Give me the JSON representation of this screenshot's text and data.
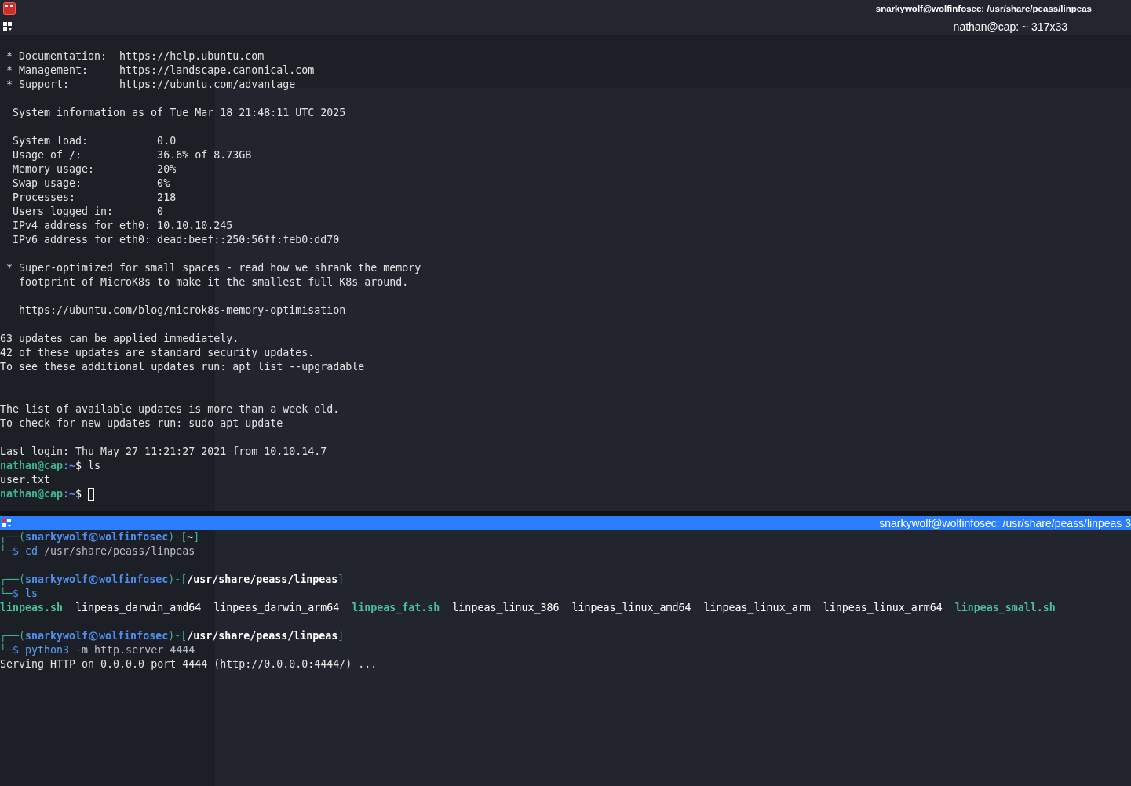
{
  "window": {
    "title": "snarkywolf@wolfinfosec: /usr/share/peass/linpeas"
  },
  "panes": [
    {
      "title": "nathan@cap: ~ 317x33",
      "active": false,
      "lines": [
        {
          "kind": "text",
          "segments": [
            {
              "kind": "output",
              "text": " * Documentation:  https://help.ubuntu.com"
            }
          ]
        },
        {
          "kind": "text",
          "segments": [
            {
              "kind": "output",
              "text": " * Management:     https://landscape.canonical.com"
            }
          ]
        },
        {
          "kind": "text",
          "segments": [
            {
              "kind": "output",
              "text": " * Support:        https://ubuntu.com/advantage"
            }
          ]
        },
        {
          "kind": "blank"
        },
        {
          "kind": "text",
          "segments": [
            {
              "kind": "output",
              "text": "  System information as of Tue Mar 18 21:48:11 UTC 2025"
            }
          ]
        },
        {
          "kind": "blank"
        },
        {
          "kind": "text",
          "segments": [
            {
              "kind": "output",
              "text": "  System load:           0.0"
            }
          ]
        },
        {
          "kind": "text",
          "segments": [
            {
              "kind": "output",
              "text": "  Usage of /:            36.6% of 8.73GB"
            }
          ]
        },
        {
          "kind": "text",
          "segments": [
            {
              "kind": "output",
              "text": "  Memory usage:          20%"
            }
          ]
        },
        {
          "kind": "text",
          "segments": [
            {
              "kind": "output",
              "text": "  Swap usage:            0%"
            }
          ]
        },
        {
          "kind": "text",
          "segments": [
            {
              "kind": "output",
              "text": "  Processes:             218"
            }
          ]
        },
        {
          "kind": "text",
          "segments": [
            {
              "kind": "output",
              "text": "  Users logged in:       0"
            }
          ]
        },
        {
          "kind": "text",
          "segments": [
            {
              "kind": "output",
              "text": "  IPv4 address for eth0: 10.10.10.245"
            }
          ]
        },
        {
          "kind": "text",
          "segments": [
            {
              "kind": "output",
              "text": "  IPv6 address for eth0: dead:beef::250:56ff:feb0:dd70"
            }
          ]
        },
        {
          "kind": "blank"
        },
        {
          "kind": "text",
          "segments": [
            {
              "kind": "output",
              "text": " * Super-optimized for small spaces - read how we shrank the memory"
            }
          ]
        },
        {
          "kind": "text",
          "segments": [
            {
              "kind": "output",
              "text": "   footprint of MicroK8s to make it the smallest full K8s around."
            }
          ]
        },
        {
          "kind": "blank"
        },
        {
          "kind": "text",
          "segments": [
            {
              "kind": "output",
              "text": "   https://ubuntu.com/blog/microk8s-memory-optimisation"
            }
          ]
        },
        {
          "kind": "blank"
        },
        {
          "kind": "text",
          "segments": [
            {
              "kind": "output",
              "text": "63 updates can be applied immediately."
            }
          ]
        },
        {
          "kind": "text",
          "segments": [
            {
              "kind": "output",
              "text": "42 of these updates are standard security updates."
            }
          ]
        },
        {
          "kind": "text",
          "segments": [
            {
              "kind": "output",
              "text": "To see these additional updates run: apt list --upgradable"
            }
          ]
        },
        {
          "kind": "blank"
        },
        {
          "kind": "blank"
        },
        {
          "kind": "text",
          "segments": [
            {
              "kind": "output",
              "text": "The list of available updates is more than a week old."
            }
          ]
        },
        {
          "kind": "text",
          "segments": [
            {
              "kind": "output",
              "text": "To check for new updates run: sudo apt update"
            }
          ]
        },
        {
          "kind": "blank"
        },
        {
          "kind": "text",
          "segments": [
            {
              "kind": "output",
              "text": "Last login: Thu May 27 11:21:27 2021 from 10.10.14.7"
            }
          ]
        },
        {
          "kind": "text",
          "segments": [
            {
              "kind": "user",
              "text": "nathan@cap"
            },
            {
              "kind": "path",
              "text": ":~"
            },
            {
              "kind": "dollar",
              "text": "$"
            },
            {
              "kind": "command",
              "text": "ls"
            }
          ]
        },
        {
          "kind": "text",
          "segments": [
            {
              "kind": "output",
              "text": "user.txt"
            }
          ]
        },
        {
          "kind": "text",
          "segments": [
            {
              "kind": "user",
              "text": "nathan@cap"
            },
            {
              "kind": "path",
              "text": ":~"
            },
            {
              "kind": "dollar",
              "text": "$"
            },
            {
              "kind": "cursor"
            }
          ]
        }
      ]
    },
    {
      "title": "snarkywolf@wolfinfosec: /usr/share/peass/linpeas 3",
      "active": true,
      "lines": [
        {
          "kind": "text",
          "segments": [
            {
              "kind": "frame",
              "text": "┌──("
            },
            {
              "kind": "zuser",
              "text": "snarkywolf"
            },
            {
              "kind": "at-icon"
            },
            {
              "kind": "zuser",
              "text": "wolfinfosec"
            },
            {
              "kind": "frame",
              "text": ")-["
            },
            {
              "kind": "zpath",
              "text": "~"
            },
            {
              "kind": "frame",
              "text": "]"
            }
          ]
        },
        {
          "kind": "text",
          "segments": [
            {
              "kind": "frame",
              "text": "└─"
            },
            {
              "kind": "zdollar",
              "text": "$"
            },
            {
              "kind": "zcommand",
              "text": "cd"
            },
            {
              "kind": "args",
              "text": "/usr/share/peass/linpeas"
            }
          ]
        },
        {
          "kind": "blank"
        },
        {
          "kind": "text",
          "segments": [
            {
              "kind": "frame",
              "text": "┌──("
            },
            {
              "kind": "zuser",
              "text": "snarkywolf"
            },
            {
              "kind": "at-icon"
            },
            {
              "kind": "zuser",
              "text": "wolfinfosec"
            },
            {
              "kind": "frame",
              "text": ")-["
            },
            {
              "kind": "zpath",
              "text": "/usr/share/peass/linpeas"
            },
            {
              "kind": "frame",
              "text": "]"
            }
          ]
        },
        {
          "kind": "text",
          "segments": [
            {
              "kind": "frame",
              "text": "└─"
            },
            {
              "kind": "zdollar",
              "text": "$"
            },
            {
              "kind": "zcommand",
              "text": "ls"
            }
          ]
        },
        {
          "kind": "text",
          "segments": [
            {
              "kind": "executable",
              "text": "linpeas.sh"
            },
            {
              "kind": "file",
              "text": "linpeas_darwin_amd64"
            },
            {
              "kind": "file",
              "text": "linpeas_darwin_arm64"
            },
            {
              "kind": "executable",
              "text": "linpeas_fat.sh"
            },
            {
              "kind": "file",
              "text": "linpeas_linux_386"
            },
            {
              "kind": "file",
              "text": "linpeas_linux_amd64"
            },
            {
              "kind": "file",
              "text": "linpeas_linux_arm"
            },
            {
              "kind": "file",
              "text": "linpeas_linux_arm64"
            },
            {
              "kind": "executable",
              "text": "linpeas_small.sh"
            }
          ]
        },
        {
          "kind": "blank"
        },
        {
          "kind": "text",
          "segments": [
            {
              "kind": "frame",
              "text": "┌──("
            },
            {
              "kind": "zuser",
              "text": "snarkywolf"
            },
            {
              "kind": "at-icon"
            },
            {
              "kind": "zuser",
              "text": "wolfinfosec"
            },
            {
              "kind": "frame",
              "text": ")-["
            },
            {
              "kind": "zpath",
              "text": "/usr/share/peass/linpeas"
            },
            {
              "kind": "frame",
              "text": "]"
            }
          ]
        },
        {
          "kind": "text",
          "segments": [
            {
              "kind": "frame",
              "text": "└─"
            },
            {
              "kind": "zdollar",
              "text": "$"
            },
            {
              "kind": "zcommand",
              "text": "python3"
            },
            {
              "kind": "args",
              "text": "-m http.server 4444"
            }
          ]
        },
        {
          "kind": "text",
          "segments": [
            {
              "kind": "output",
              "text": "Serving HTTP on 0.0.0.0 port 4444 (http://0.0.0.0:4444/) ..."
            }
          ]
        }
      ]
    }
  ]
}
